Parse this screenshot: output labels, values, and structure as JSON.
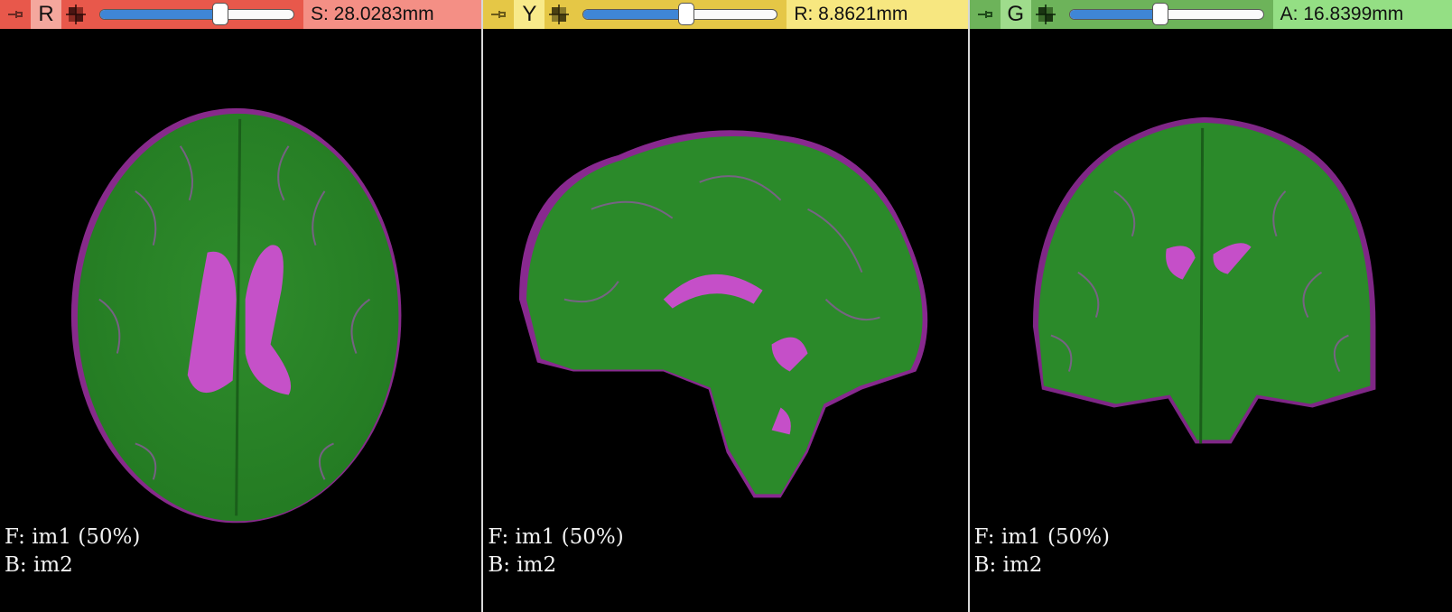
{
  "views": [
    {
      "id": "red",
      "letter": "R",
      "readout": "S: 28.0283mm",
      "slider_fraction": 0.62,
      "color": "#e8584b",
      "overlay": {
        "foreground": "F: im1 (50%)",
        "background": "B: im2"
      }
    },
    {
      "id": "yellow",
      "letter": "Y",
      "readout": "R: 8.8621mm",
      "slider_fraction": 0.53,
      "color": "#e5c746",
      "overlay": {
        "foreground": "F: im1 (50%)",
        "background": "B: im2"
      }
    },
    {
      "id": "green",
      "letter": "G",
      "readout": "A: 16.8399mm",
      "slider_fraction": 0.47,
      "color": "#6db35a",
      "overlay": {
        "foreground": "F: im1 (50%)",
        "background": "B: im2"
      }
    }
  ],
  "icons": {
    "pin": "pin-icon",
    "link": "link-icon"
  },
  "palette": {
    "tissue_green": "#2c8a2a",
    "overlay_magenta": "#cc3ccc"
  }
}
